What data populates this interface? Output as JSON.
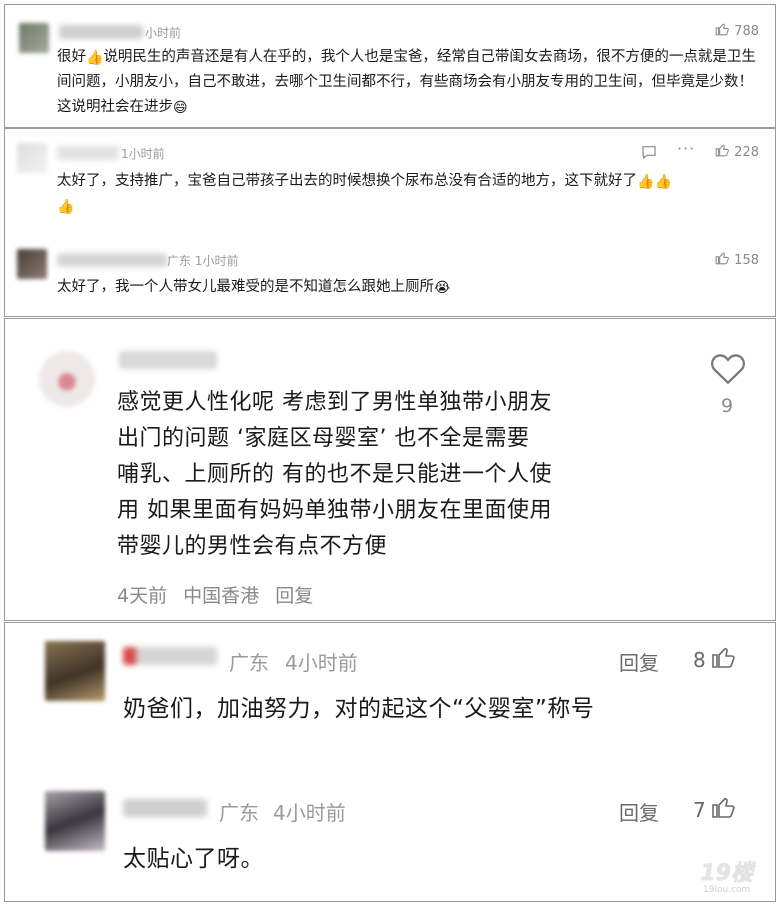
{
  "colors": {
    "meta_gray": "#9a9a9a",
    "text": "#1a1a1a",
    "accent_thumb": "#f2b233",
    "border": "#9a9a9a"
  },
  "comment1": {
    "time": "小时前",
    "likes": "788",
    "text_before_emoji": "很好",
    "text_after_emoji": "说明民生的声音还是有人在乎的，我个人也是宝爸，经常自己带闺女去商场，很不方便的一点就是卫生间问题，小朋友小，自己不敢进，去哪个卫生间都不行，有些商场会有小朋友专用的卫生间，但毕竟是少数！这说明社会在进步",
    "emoji_1": "👍",
    "emoji_2": "😄"
  },
  "comment2": {
    "time": "1小时前",
    "likes": "228",
    "text": "太好了，支持推广，宝爸自己带孩子出去的时候想换个尿布总没有合适的地方，这下就好了",
    "emoji": "👍"
  },
  "comment3": {
    "location_time": "广东 1小时前",
    "likes": "158",
    "text": "太好了，我一个人带女儿最难受的是不知道怎么跟她上厕所",
    "emoji": "😭"
  },
  "comment4": {
    "likes": "9",
    "lines": [
      "感觉更人性化呢 考虑到了男性单独带小朋友",
      "出门的问题 ‘家庭区母婴室’ 也不全是需要",
      "哺乳、上厕所的 有的也不是只能进一个人使",
      "用 如果里面有妈妈单独带小朋友在里面使用",
      "带婴儿的男性会有点不方便"
    ],
    "footer_time": "4天前",
    "footer_location": "中国香港",
    "footer_reply": "回复"
  },
  "comment5": {
    "location": "广东",
    "time": "4小时前",
    "reply": "回复",
    "likes": "8",
    "text": "奶爸们，加油努力，对的起这个“父婴室”称号"
  },
  "comment6": {
    "location": "广东",
    "time": "4小时前",
    "reply": "回复",
    "likes": "7",
    "text": "太贴心了呀。"
  },
  "watermark": {
    "brand": "19楼",
    "domain": "19lou.com"
  }
}
